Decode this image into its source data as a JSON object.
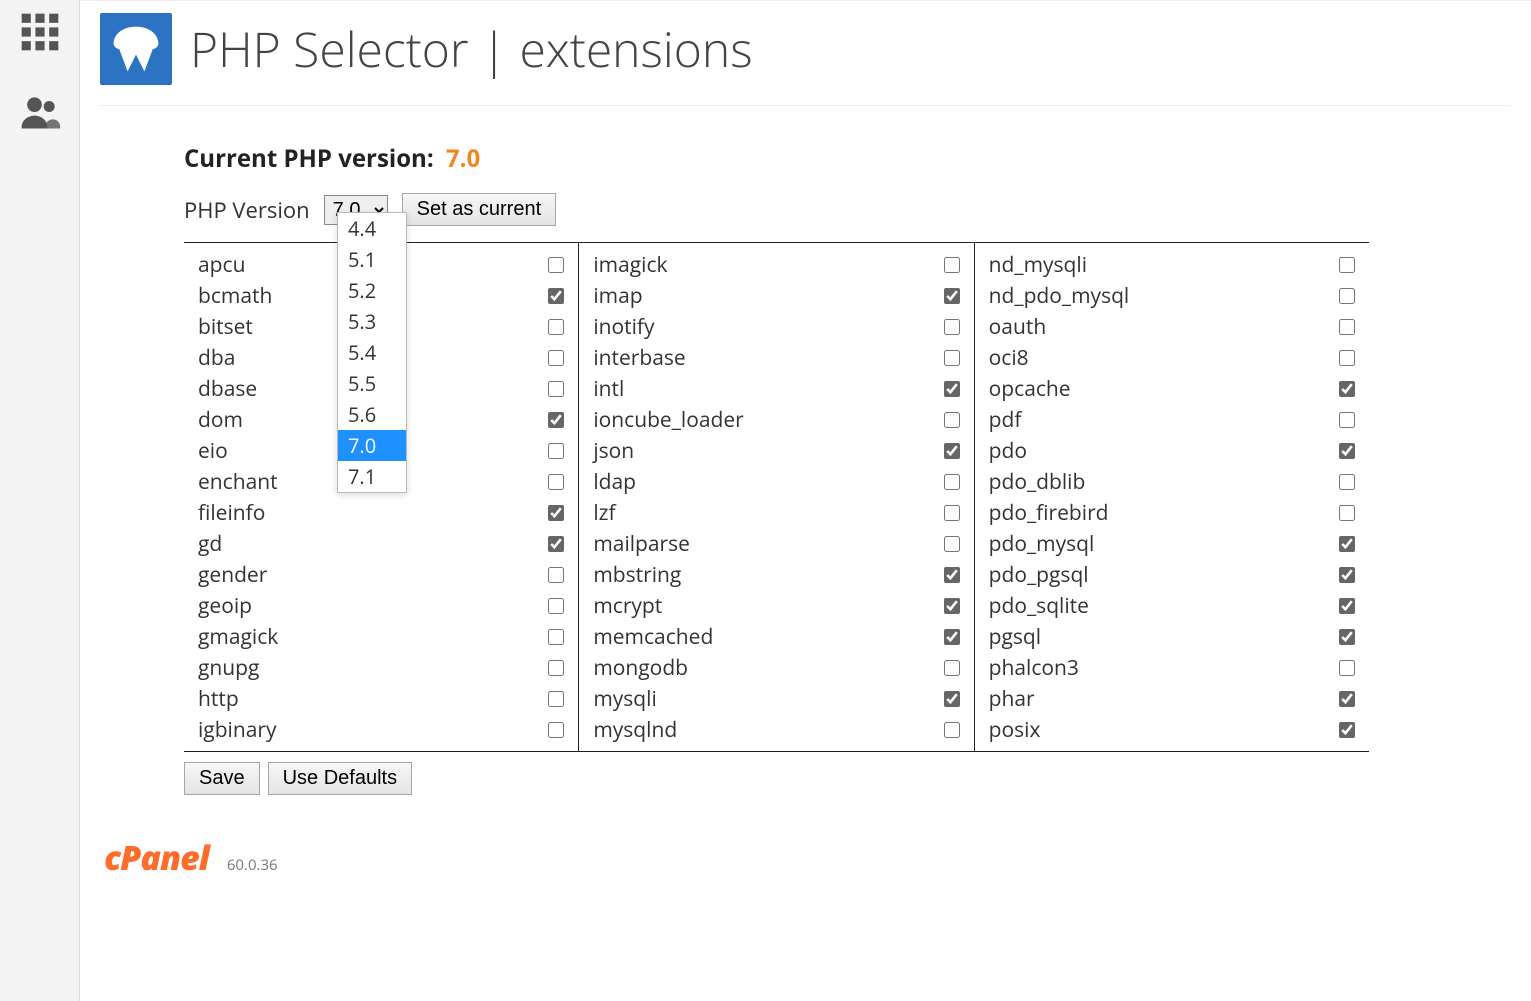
{
  "page_title": "PHP Selector | extensions",
  "current_version_label": "Current PHP version:",
  "current_version_value": "7.0",
  "php_version_label": "PHP Version",
  "selected_dropdown_value": "7.0",
  "set_as_current_label": "Set as current",
  "dropdown_options": [
    "4.4",
    "5.1",
    "5.2",
    "5.3",
    "5.4",
    "5.5",
    "5.6",
    "7.0",
    "7.1"
  ],
  "dropdown_selected": "7.0",
  "save_label": "Save",
  "use_defaults_label": "Use Defaults",
  "cpanel_brand": "cPanel",
  "cpanel_version": "60.0.36",
  "extensions": {
    "col1": [
      {
        "name": "apcu",
        "checked": false
      },
      {
        "name": "bcmath",
        "checked": true
      },
      {
        "name": "bitset",
        "checked": false
      },
      {
        "name": "dba",
        "checked": false
      },
      {
        "name": "dbase",
        "checked": false
      },
      {
        "name": "dom",
        "checked": true
      },
      {
        "name": "eio",
        "checked": false
      },
      {
        "name": "enchant",
        "checked": false
      },
      {
        "name": "fileinfo",
        "checked": true
      },
      {
        "name": "gd",
        "checked": true
      },
      {
        "name": "gender",
        "checked": false
      },
      {
        "name": "geoip",
        "checked": false
      },
      {
        "name": "gmagick",
        "checked": false
      },
      {
        "name": "gnupg",
        "checked": false
      },
      {
        "name": "http",
        "checked": false
      },
      {
        "name": "igbinary",
        "checked": false
      }
    ],
    "col2": [
      {
        "name": "imagick",
        "checked": false
      },
      {
        "name": "imap",
        "checked": true
      },
      {
        "name": "inotify",
        "checked": false
      },
      {
        "name": "interbase",
        "checked": false
      },
      {
        "name": "intl",
        "checked": true
      },
      {
        "name": "ioncube_loader",
        "checked": false
      },
      {
        "name": "json",
        "checked": true
      },
      {
        "name": "ldap",
        "checked": false
      },
      {
        "name": "lzf",
        "checked": false
      },
      {
        "name": "mailparse",
        "checked": false
      },
      {
        "name": "mbstring",
        "checked": true
      },
      {
        "name": "mcrypt",
        "checked": true
      },
      {
        "name": "memcached",
        "checked": true
      },
      {
        "name": "mongodb",
        "checked": false
      },
      {
        "name": "mysqli",
        "checked": true
      },
      {
        "name": "mysqlnd",
        "checked": false
      }
    ],
    "col3": [
      {
        "name": "nd_mysqli",
        "checked": false
      },
      {
        "name": "nd_pdo_mysql",
        "checked": false
      },
      {
        "name": "oauth",
        "checked": false
      },
      {
        "name": "oci8",
        "checked": false
      },
      {
        "name": "opcache",
        "checked": true
      },
      {
        "name": "pdf",
        "checked": false
      },
      {
        "name": "pdo",
        "checked": true
      },
      {
        "name": "pdo_dblib",
        "checked": false
      },
      {
        "name": "pdo_firebird",
        "checked": false
      },
      {
        "name": "pdo_mysql",
        "checked": true
      },
      {
        "name": "pdo_pgsql",
        "checked": true
      },
      {
        "name": "pdo_sqlite",
        "checked": true
      },
      {
        "name": "pgsql",
        "checked": true
      },
      {
        "name": "phalcon3",
        "checked": false
      },
      {
        "name": "phar",
        "checked": true
      },
      {
        "name": "posix",
        "checked": true
      }
    ]
  }
}
